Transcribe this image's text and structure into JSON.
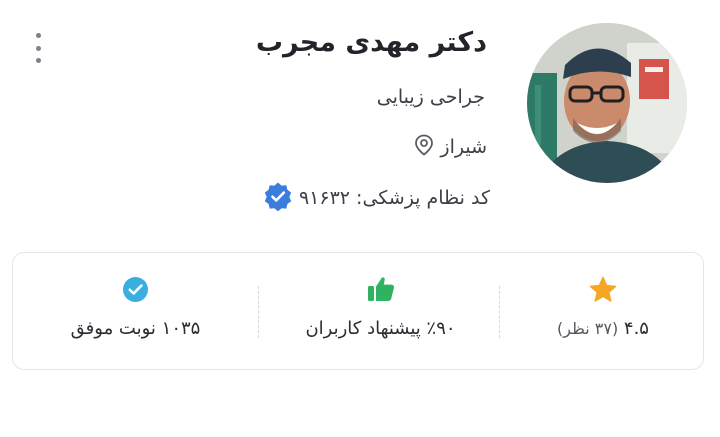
{
  "doctor": {
    "name": "دکتر مهدی مجرب",
    "specialty": "جراحی زیبایی",
    "city": "شیراز",
    "medical_code": "کد نظام پزشکی: ۹۱۶۳۲"
  },
  "stats": {
    "rating": {
      "value": "۴.۵",
      "count": "(۳۷ نظر)",
      "icon": "star-icon"
    },
    "recommend": {
      "text": "٪۹۰ پیشنهاد کاربران",
      "icon": "thumbs-up-icon"
    },
    "visits": {
      "text": "۱۰۳۵ نوبت موفق",
      "icon": "check-circle-icon"
    }
  },
  "colors": {
    "star": "#f5a623",
    "thumbs_up": "#2eb360",
    "check_circle": "#3aaee0",
    "verified_badge": "#3b7ddd"
  }
}
